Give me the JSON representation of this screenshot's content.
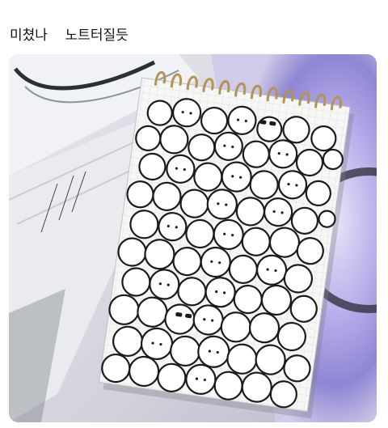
{
  "post": {
    "text": "미쳤나    노트터질듯"
  },
  "media": {
    "alt_icon": "photo-icon",
    "colors": {
      "paper": "#f7f7f5",
      "grid": "#d9dde3",
      "ink": "#1b1b1b",
      "ring": "#b99a5a",
      "desk_white": "#eceef2",
      "lavender": "#c9c3e8",
      "violet": "#7b72c9"
    }
  }
}
